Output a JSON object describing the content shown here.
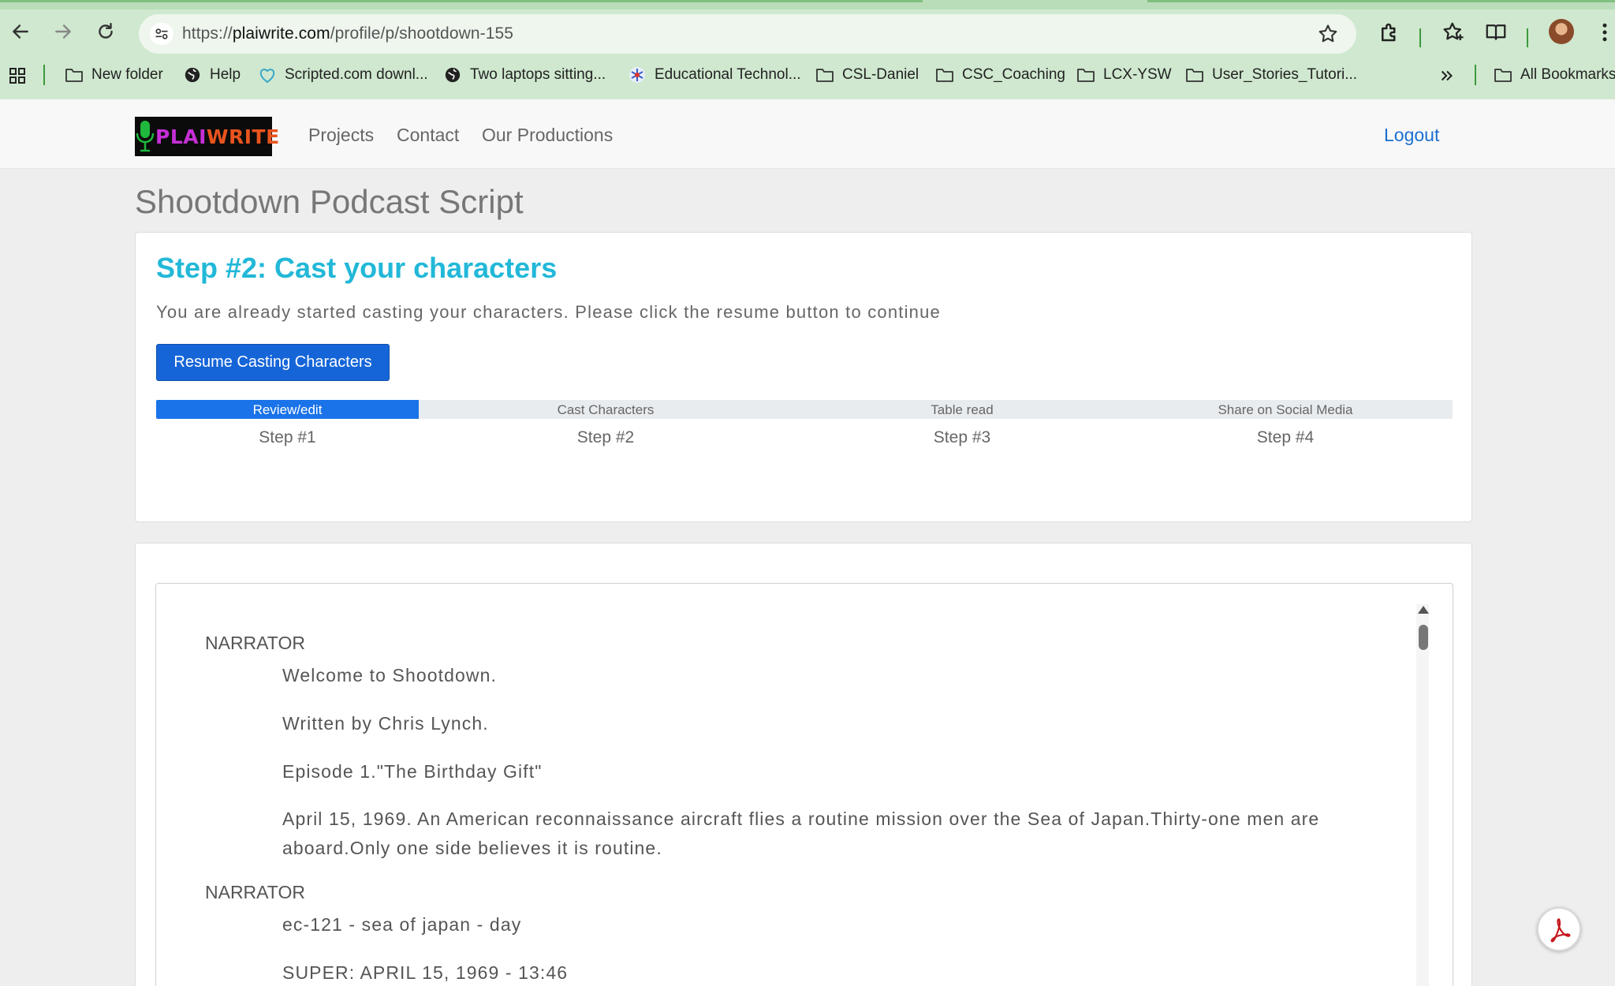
{
  "browser": {
    "url_scheme": "https://",
    "url_host": "plaiwrite.com",
    "url_path": "/profile/p/shootdown-155",
    "bookmarks": [
      {
        "label": "New folder",
        "icon": "folder-icon"
      },
      {
        "label": "Help",
        "icon": "globe-icon"
      },
      {
        "label": "Scripted.com downl...",
        "icon": "scripted-icon"
      },
      {
        "label": "Two laptops sitting...",
        "icon": "globe-icon"
      },
      {
        "label": "Educational Technol...",
        "icon": "snowflake-icon"
      },
      {
        "label": "CSL-Daniel",
        "icon": "folder-icon"
      },
      {
        "label": "CSC_Coaching",
        "icon": "folder-icon"
      },
      {
        "label": "LCX-YSW",
        "icon": "folder-icon"
      },
      {
        "label": "User_Stories_Tutori...",
        "icon": "folder-icon"
      }
    ],
    "all_bookmarks": "All Bookmarks"
  },
  "site": {
    "logo_text_a": "PLAI",
    "logo_text_b": "WRITE",
    "nav": [
      "Projects",
      "Contact",
      "Our Productions"
    ],
    "logout": "Logout"
  },
  "page": {
    "title": "Shootdown Podcast Script",
    "step_heading": "Step #2: Cast your characters",
    "step_desc": "You are already started casting your characters. Please click the resume button to continue",
    "resume_button": "Resume Casting Characters",
    "progress_fraction": 0.2
  },
  "steps": [
    {
      "label": "Review/edit",
      "num": "Step #1"
    },
    {
      "label": "Cast Characters",
      "num": "Step #2"
    },
    {
      "label": "Table read",
      "num": "Step #3"
    },
    {
      "label": "Share on Social Media",
      "num": "Step #4"
    }
  ],
  "script": [
    {
      "speaker": "NARRATOR"
    },
    {
      "line": "Welcome to Shootdown."
    },
    {
      "line": "Written by Chris Lynch."
    },
    {
      "line": "Episode 1.\"The Birthday Gift\""
    },
    {
      "line": "April 15, 1969. An American reconnaissance aircraft flies a routine mission over the Sea of Japan.Thirty-one men are aboard.Only one side believes it is routine."
    },
    {
      "speaker": "NARRATOR"
    },
    {
      "line": "ec-121 - sea of japan - day"
    },
    {
      "line": "SUPER: APRIL 15, 1969 - 13:46"
    }
  ]
}
